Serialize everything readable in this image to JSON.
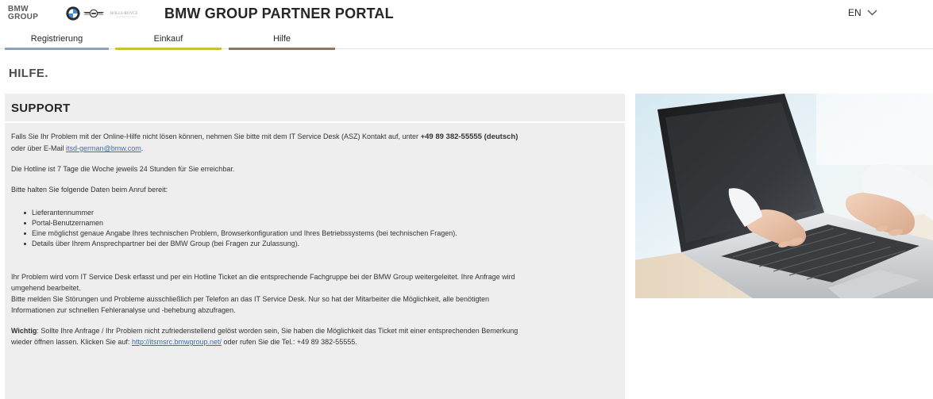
{
  "header": {
    "group_logo_line1": "BMW",
    "group_logo_line2": "GROUP",
    "rr_logo_text": "ROLLS-ROYCE",
    "title": "BMW GROUP PARTNER PORTAL",
    "language": "EN"
  },
  "nav": {
    "tabs": [
      {
        "label": "Registrierung"
      },
      {
        "label": "Einkauf"
      },
      {
        "label": "Hilfe"
      }
    ]
  },
  "page": {
    "title": "HILFE."
  },
  "support": {
    "title": "SUPPORT",
    "intro_text": "Falls Sie Ihr Problem mit der Online-Hilfe nicht lösen können, nehmen Sie bitte mit dem IT Service Desk (ASZ) Kontakt auf, unter",
    "intro_phone": "+49 89 382-55555 (deutsch)",
    "intro_email_prefix": "oder über E-Mail",
    "intro_email": "itsd-german@bmw.com",
    "intro_email_suffix": ".",
    "hotline_text": "Die Hotline ist 7 Tage die Woche jeweils 24 Stunden für Sie erreichbar.",
    "prepare_text": "Bitte halten Sie folgende Daten beim Anruf bereit:",
    "data_items": [
      "Lieferantennummer",
      "Portal-Benutzernamen",
      "Eine möglichst genaue Angabe Ihres technischen Problem, Browserkonfiguration und Ihres Betriebssystems (bei technischen Fragen).",
      "Details über Ihrem Ansprechpartner bei der BMW Group (bei Fragen zur Zulassung)."
    ],
    "process_line1": "Ihr Problem wird vom IT Service Desk erfasst und per ein Hotline Ticket an die entsprechende Fachgruppe bei der BMW Group weitergeleitet. Ihre Anfrage wird",
    "process_line2": "umgehend bearbeitet.",
    "phone_only_line1": "Bitte melden Sie Störungen und Probleme ausschließlich per Telefon an das IT Service Desk. Nur so hat der Mitarbeiter die Möglichkeit, alle benötigten",
    "phone_only_line2": "Informationen zur schnellen Fehleranalyse und -behebung abzufragen.",
    "important_label": "Wichtig",
    "important_text_line1": ": Sollte Ihre Anfrage / Ihr Problem nicht zufriedenstellend gelöst worden sein, Sie haben die Möglichkeit das Ticket mit einer entsprechenden Bemerkung",
    "important_text_line2": "wieder öffnen lassen. Klicken Sie auf:",
    "important_link": "http://itsmsrc.bmwgroup.net/",
    "important_text_line3": " oder rufen Sie die Tel.: +49 89 382-55555."
  },
  "colors": {
    "tab_registrierung": "#8fa2b8",
    "tab_einkauf": "#c9c237",
    "tab_hilfe": "#8a7a66",
    "panel_background": "#eeeeee",
    "link": "#3a6fb5"
  },
  "icons": {
    "bmw_logo": "bmw-roundel-icon",
    "mini_logo": "mini-wings-icon",
    "language_dropdown": "chevron-down-icon"
  }
}
